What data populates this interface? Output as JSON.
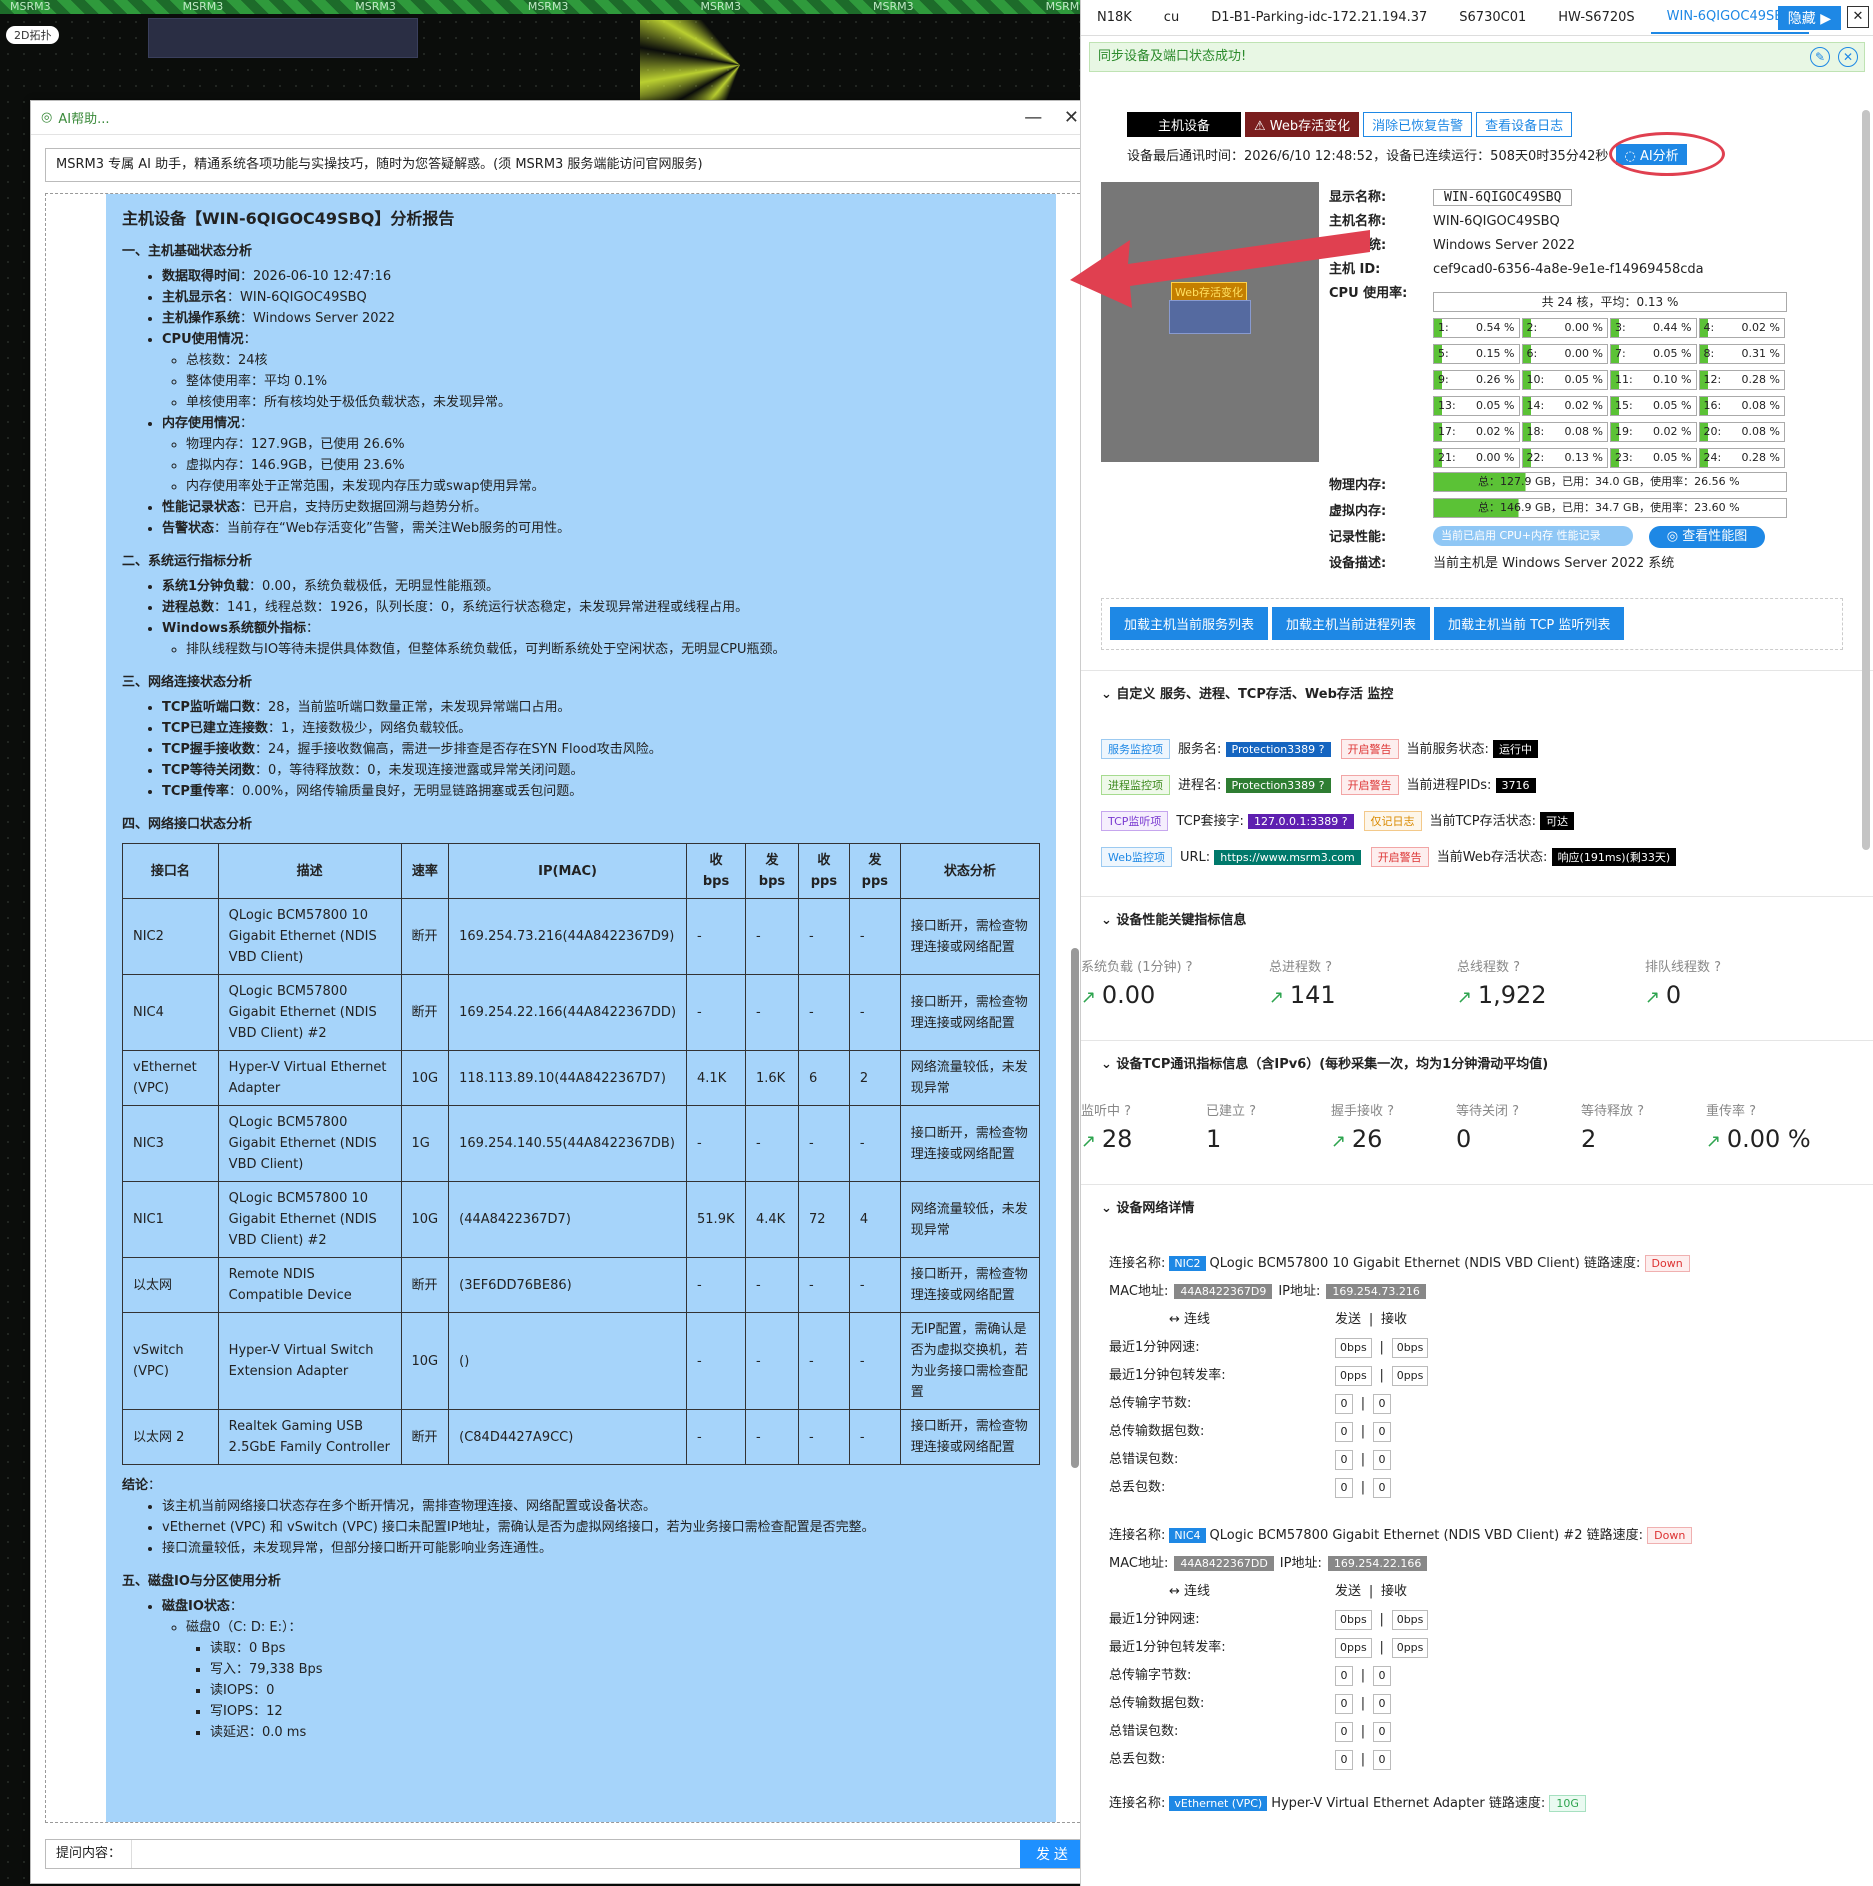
{
  "topo": {
    "strip": [
      "MSRM3",
      "MSRM3",
      "MSRM3",
      "MSRM3",
      "MSRM3",
      "MSRM3",
      "MSRM3",
      "MSRM3",
      "MSRM3",
      "MSRM3",
      "MSRM3"
    ],
    "tag": "2D拓扑"
  },
  "ai": {
    "title": "AI帮助...",
    "controls": "— ✕",
    "intro": "MSRM3 专属 AI 助手，精通系统各项功能与实操技巧，随时为您答疑解惑。(须 MSRM3 服务端能访问官网服务)",
    "report_title": "主机设备【WIN-6QIGOC49SBQ】分析报告",
    "s1": "一、主机基础状态分析",
    "s1_items": [
      {
        "k": "数据取得时间",
        "v": "：2026-06-10 12:47:16"
      },
      {
        "k": "主机显示名",
        "v": "：WIN-6QIGOC49SBQ"
      },
      {
        "k": "主机操作系统",
        "v": "：Windows Server 2022"
      },
      {
        "k": "CPU使用情况",
        "v": "："
      }
    ],
    "cpu_sub": [
      "总核数：24核",
      "整体使用率：平均 0.1%",
      "单核使用率：所有核均处于极低负载状态，未发现异常。"
    ],
    "mem_k": "内存使用情况",
    "mem_sub": [
      "物理内存：127.9GB，已使用 26.6%",
      "虚拟内存：146.9GB，已使用 23.6%",
      "内存使用率处于正常范围，未发现内存压力或swap使用异常。"
    ],
    "perf_k": "性能记录状态",
    "perf_v": "：已开启，支持历史数据回溯与趋势分析。",
    "alarm_k": "告警状态",
    "alarm_v": "：当前存在“Web存活变化”告警，需关注Web服务的可用性。",
    "s2": "二、系统运行指标分析",
    "s2_items": [
      {
        "k": "系统1分钟负载",
        "v": "：0.00，系统负载极低，无明显性能瓶颈。"
      },
      {
        "k": "进程总数",
        "v": "：141，线程总数：1926，队列长度：0，系统运行状态稳定，未发现异常进程或线程占用。"
      },
      {
        "k": "Windows系统额外指标",
        "v": "："
      }
    ],
    "s2_sub": "排队线程数与IO等待未提供具体数值，但整体系统负载低，可判断系统处于空闲状态，无明显CPU瓶颈。",
    "s3": "三、网络连接状态分析",
    "s3_items": [
      {
        "k": "TCP监听端口数",
        "v": "：28，当前监听端口数量正常，未发现异常端口占用。"
      },
      {
        "k": "TCP已建立连接数",
        "v": "：1，连接数极少，网络负载较低。"
      },
      {
        "k": "TCP握手接收数",
        "v": "：24，握手接收数偏高，需进一步排查是否存在SYN Flood攻击风险。"
      },
      {
        "k": "TCP等待关闭数",
        "v": "：0，等待释放数：0，未发现连接泄露或异常关闭问题。"
      },
      {
        "k": "TCP重传率",
        "v": "：0.00%，网络传输质量良好，无明显链路拥塞或丢包问题。"
      }
    ],
    "s4": "四、网络接口状态分析",
    "table_head": [
      "接口名",
      "描述",
      "速率",
      "IP(MAC)",
      "收bps",
      "发bps",
      "收pps",
      "发pps",
      "状态分析"
    ],
    "table_rows": [
      [
        "NIC2",
        "QLogic BCM57800 10 Gigabit Ethernet (NDIS VBD Client)",
        "断开",
        "169.254.73.216(44A8422367D9)",
        "-",
        "-",
        "-",
        "-",
        "接口断开，需检查物理连接或网络配置"
      ],
      [
        "NIC4",
        "QLogic BCM57800 Gigabit Ethernet (NDIS VBD Client) #2",
        "断开",
        "169.254.22.166(44A8422367DD)",
        "-",
        "-",
        "-",
        "-",
        "接口断开，需检查物理连接或网络配置"
      ],
      [
        "vEthernet (VPC)",
        "Hyper-V Virtual Ethernet Adapter",
        "10G",
        "118.113.89.10(44A8422367D7)",
        "4.1K",
        "1.6K",
        "6",
        "2",
        "网络流量较低，未发现异常"
      ],
      [
        "NIC3",
        "QLogic BCM57800 Gigabit Ethernet (NDIS VBD Client)",
        "1G",
        "169.254.140.55(44A8422367DB)",
        "-",
        "-",
        "-",
        "-",
        "接口断开，需检查物理连接或网络配置"
      ],
      [
        "NIC1",
        "QLogic BCM57800 10 Gigabit Ethernet (NDIS VBD Client) #2",
        "10G",
        "(44A8422367D7)",
        "51.9K",
        "4.4K",
        "72",
        "4",
        "网络流量较低，未发现异常"
      ],
      [
        "以太网",
        "Remote NDIS Compatible Device",
        "断开",
        "(3EF6DD76BE86)",
        "-",
        "-",
        "-",
        "-",
        "接口断开，需检查物理连接或网络配置"
      ],
      [
        "vSwitch (VPC)",
        "Hyper-V Virtual Switch Extension Adapter",
        "10G",
        "()",
        "-",
        "-",
        "-",
        "-",
        "无IP配置，需确认是否为虚拟交换机，若为业务接口需检查配置"
      ],
      [
        "以太网 2",
        "Realtek Gaming USB 2.5GbE Family Controller",
        "断开",
        "(C84D4427A9CC)",
        "-",
        "-",
        "-",
        "-",
        "接口断开，需检查物理连接或网络配置"
      ]
    ],
    "concl_k": "结论",
    "concl": [
      "该主机当前网络接口状态存在多个断开情况，需排查物理连接、网络配置或设备状态。",
      "vEthernet (VPC) 和 vSwitch (VPC) 接口未配置IP地址，需确认是否为虚拟网络接口，若为业务接口需检查配置是否完整。",
      "接口流量较低，未发现异常，但部分接口断开可能影响业务连通性。"
    ],
    "s5": "五、磁盘IO与分区使用分析",
    "disk_k": "磁盘IO状态",
    "disk0": "磁盘0（C: D: E:）：",
    "disk0_sub": [
      "读取：0 Bps",
      "写入：79,338 Bps",
      "读IOPS：0",
      "写IOPS：12",
      "读延迟：0.0 ms"
    ],
    "ask_label": "提问内容：",
    "send": "发 送"
  },
  "rp": {
    "tabs": [
      "N18K",
      "cu",
      "D1-B1-Parking-idc-172.21.194.37",
      "S6730C01",
      "HW-S6720S",
      "WIN-6QIGOC49SBQ"
    ],
    "hide": "隐藏 ▶",
    "close": "✕",
    "sync_msg": "同步设备及端口状态成功!",
    "btns": [
      "主机设备",
      "⚠ Web存活变化",
      "消除已恢复告警",
      "查看设备日志"
    ],
    "status": "设备最后通讯时间：2026/6/10 12:48:52，设备已连续运行：508天0时35分42秒",
    "ai_btn": "◌ AI分析",
    "web_tag": "Web存活变化",
    "info": [
      {
        "k": "显示名称:",
        "v": "WIN-6QIGOC49SBQ"
      },
      {
        "k": "主机名称:",
        "v": "WIN-6QIGOC49SBQ"
      },
      {
        "k": "操作系统:",
        "v": "Windows Server 2022"
      },
      {
        "k": "主机 ID:",
        "v": "cef9cad0-6356-4a8e-9e1e-f14969458cda"
      },
      {
        "k": "CPU 使用率:",
        "v": ""
      }
    ],
    "cpu_total": "共 24 核，平均：0.13 %",
    "cores": [
      [
        "1:",
        "0.54 %"
      ],
      [
        "2:",
        "0.00 %"
      ],
      [
        "3:",
        "0.44 %"
      ],
      [
        "4:",
        "0.02 %"
      ],
      [
        "5:",
        "0.15 %"
      ],
      [
        "6:",
        "0.00 %"
      ],
      [
        "7:",
        "0.05 %"
      ],
      [
        "8:",
        "0.31 %"
      ],
      [
        "9:",
        "0.26 %"
      ],
      [
        "10:",
        "0.05 %"
      ],
      [
        "11:",
        "0.10 %"
      ],
      [
        "12:",
        "0.28 %"
      ],
      [
        "13:",
        "0.05 %"
      ],
      [
        "14:",
        "0.02 %"
      ],
      [
        "15:",
        "0.05 %"
      ],
      [
        "16:",
        "0.08 %"
      ],
      [
        "17:",
        "0.02 %"
      ],
      [
        "18:",
        "0.08 %"
      ],
      [
        "19:",
        "0.02 %"
      ],
      [
        "20:",
        "0.08 %"
      ],
      [
        "21:",
        "0.00 %"
      ],
      [
        "22:",
        "0.13 %"
      ],
      [
        "23:",
        "0.05 %"
      ],
      [
        "24:",
        "0.28 %"
      ]
    ],
    "phys_k": "物理内存:",
    "phys_v": "总：127.9 GB，已用：34.0 GB，使用率：26.56 %",
    "virt_k": "虚拟内存:",
    "virt_v": "总：146.9 GB，已用：34.7 GB，使用率：23.60 %",
    "rec_k": "记录性能:",
    "rec_toggle": "当前已启用 CPU+内存 性能记录",
    "perf_btn": "◎ 查看性能图",
    "desc_k": "设备描述:",
    "desc_v": "当前主机是 Windows Server 2022 系统",
    "load_btns": [
      "加载主机当前服务列表",
      "加载主机当前进程列表",
      "加载主机当前 TCP 监听列表"
    ],
    "sec_custom": "⌄ 自定义 服务、进程、TCP存活、Web存活 监控",
    "mon": [
      {
        "tag": "服务监控项",
        "k": "服务名:",
        "pill": "Protection3389 ?",
        "pc": "#1565c0",
        "warn": "开启警告",
        "sk": "当前服务状态:",
        "sv": "运行中"
      },
      {
        "tag": "进程监控项",
        "k": "进程名:",
        "pill": "Protection3389 ?",
        "pc": "#2e7d32",
        "warn": "开启警告",
        "sk": "当前进程PIDs:",
        "sv": "3716"
      },
      {
        "tag": "TCP监听项",
        "k": "TCP套接字:",
        "pill": "127.0.0.1:3389 ?",
        "pc": "#5e1fb0",
        "warn": "仅记日志",
        "sk": "当前TCP存活状态:",
        "sv": "可达"
      },
      {
        "tag": "Web监控项",
        "k": "URL:",
        "pill": "https://www.msrm3.com",
        "pc": "#00796b",
        "warn": "开启警告",
        "sk": "当前Web存活状态:",
        "sv": "响应(191ms)(剩33天)"
      }
    ],
    "sec_perf": "⌄ 设备性能关键指标信息",
    "perf": [
      [
        "系统负载 (1分钟) ?",
        "0.00"
      ],
      [
        "总进程数 ?",
        "141"
      ],
      [
        "总线程数 ?",
        "1,922"
      ],
      [
        "排队线程数 ?",
        "0"
      ]
    ],
    "sec_tcp": "⌄ 设备TCP通讯指标信息（含IPv6）(每秒采集一次，均为1分钟滑动平均值)",
    "tcp": [
      [
        "监听中 ?",
        "28",
        true
      ],
      [
        "已建立 ?",
        "1",
        false
      ],
      [
        "握手接收 ?",
        "26",
        true
      ],
      [
        "等待关闭 ?",
        "0",
        false
      ],
      [
        "等待释放 ?",
        "2",
        false
      ],
      [
        "重传率 ?",
        "0.00 %",
        true
      ]
    ],
    "sec_net": "⌄ 设备网络详情",
    "nics": [
      {
        "cn": "连接名称:",
        "nb": "NIC2",
        "desc": "QLogic BCM57800 10 Gigabit Ethernet (NDIS VBD Client)",
        "sp": "链路速度:",
        "spd": "Down",
        "mac_k": "MAC地址:",
        "mac": "44A8422367D9",
        "ip_k": "IP地址:",
        "ip": "169.254.73.216",
        "lk": "↔ 连线",
        "tx": "发送",
        "rx": "接收",
        "rows": [
          [
            "最近1分钟网速:",
            "0bps",
            "0bps"
          ],
          [
            "最近1分钟包转发率:",
            "0pps",
            "0pps"
          ],
          [
            "总传输字节数:",
            "0",
            "0"
          ],
          [
            "总传输数据包数:",
            "0",
            "0"
          ],
          [
            "总错误包数:",
            "0",
            "0"
          ],
          [
            "总丢包数:",
            "0",
            "0"
          ]
        ]
      },
      {
        "cn": "连接名称:",
        "nb": "NIC4",
        "desc": "QLogic BCM57800 Gigabit Ethernet (NDIS VBD Client) #2",
        "sp": "链路速度:",
        "spd": "Down",
        "mac_k": "MAC地址:",
        "mac": "44A8422367DD",
        "ip_k": "IP地址:",
        "ip": "169.254.22.166",
        "lk": "↔ 连线",
        "tx": "发送",
        "rx": "接收",
        "rows": [
          [
            "最近1分钟网速:",
            "0bps",
            "0bps"
          ],
          [
            "最近1分钟包转发率:",
            "0pps",
            "0pps"
          ],
          [
            "总传输字节数:",
            "0",
            "0"
          ],
          [
            "总传输数据包数:",
            "0",
            "0"
          ],
          [
            "总错误包数:",
            "0",
            "0"
          ],
          [
            "总丢包数:",
            "0",
            "0"
          ]
        ]
      }
    ],
    "nic3": {
      "cn": "连接名称:",
      "nb": "vEthernet (VPC)",
      "desc": "Hyper-V Virtual Ethernet Adapter",
      "sp": "链路速度:",
      "spd": "10G"
    }
  }
}
